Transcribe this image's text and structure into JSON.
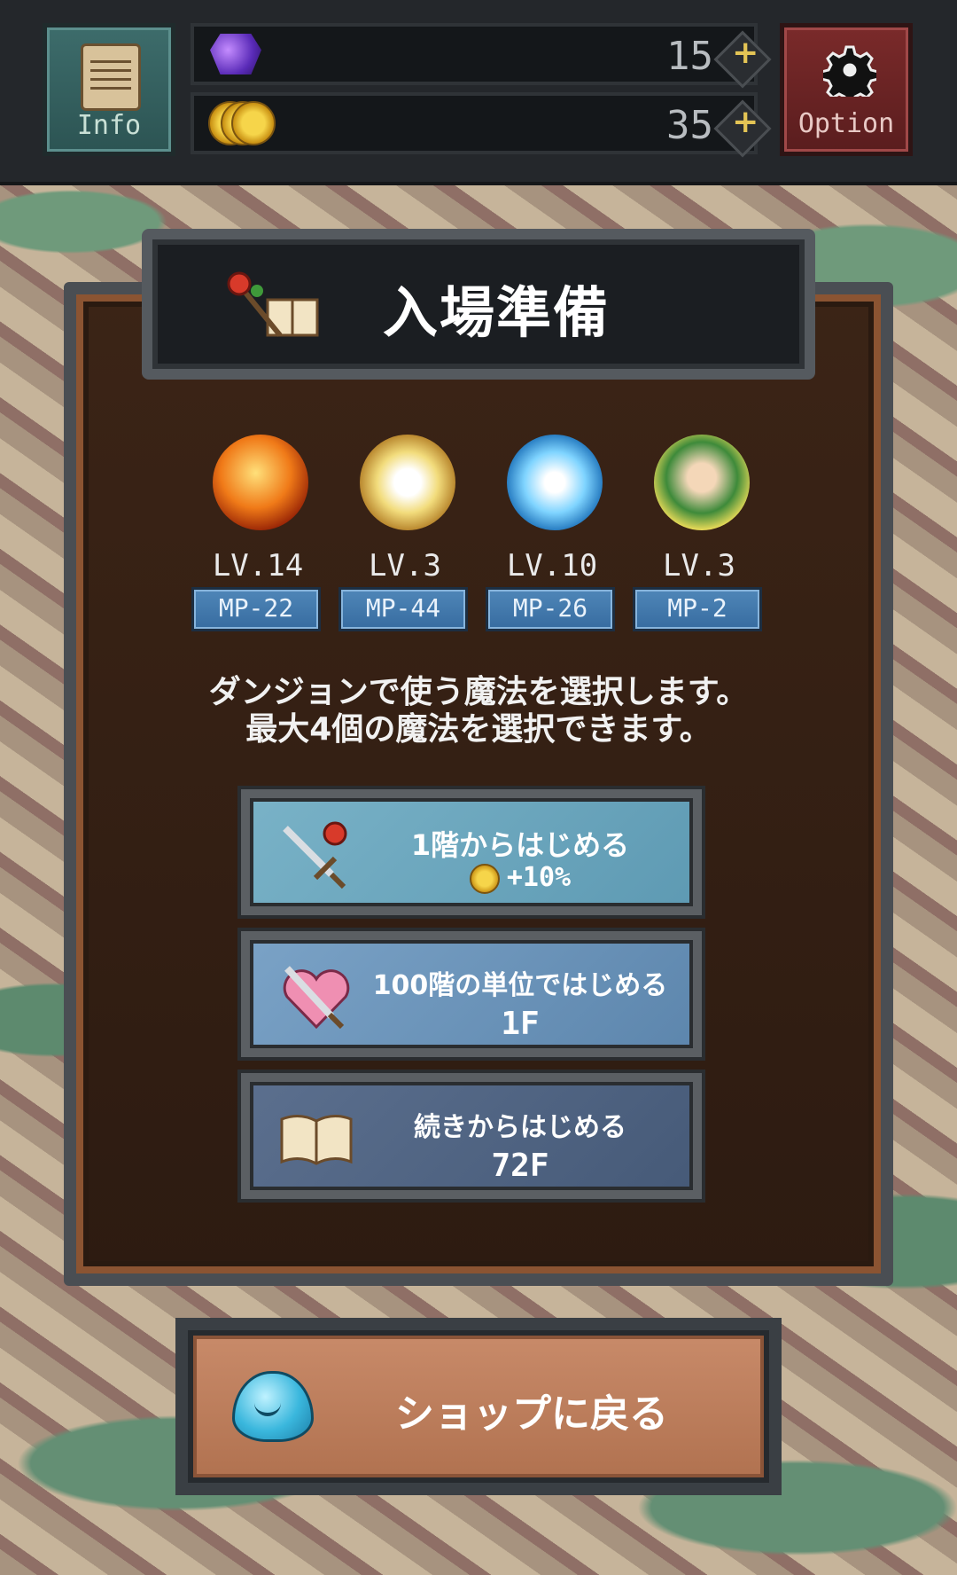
{
  "hud": {
    "info_label": "Info",
    "gems": "15",
    "coins": "35",
    "option_label": "Option",
    "plus_symbol": "+"
  },
  "title": "入場準備",
  "spells": [
    {
      "icon": "fireball-icon",
      "level": "LV.14",
      "mp": "MP-22"
    },
    {
      "icon": "holy-cross-icon",
      "level": "LV.3",
      "mp": "MP-44"
    },
    {
      "icon": "ice-vortex-icon",
      "level": "LV.10",
      "mp": "MP-26"
    },
    {
      "icon": "archer-girl-icon",
      "level": "LV.3",
      "mp": "MP-2"
    }
  ],
  "description": {
    "line1": "ダンジョンで使う魔法を選択します。",
    "line2": "最大4個の魔法を選択できます。"
  },
  "options": [
    {
      "line1": "1階からはじめる",
      "line2": "+10%"
    },
    {
      "line1": "100階の単位ではじめる",
      "line2": "1F"
    },
    {
      "line1": "続きからはじめる",
      "line2": "72F"
    }
  ],
  "back_button": "ショップに戻る"
}
